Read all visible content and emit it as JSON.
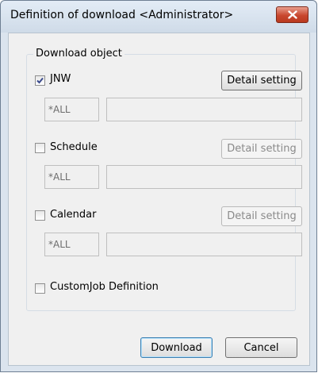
{
  "window": {
    "title": "Definition of download <Administrator>"
  },
  "icons": {
    "close": "close-icon",
    "check": "checkmark-icon"
  },
  "group": {
    "label": "Download object"
  },
  "items": [
    {
      "label": "JNW",
      "checked": true,
      "detail_label": "Detail setting",
      "detail_enabled": true,
      "code_value": "*ALL",
      "desc_value": ""
    },
    {
      "label": "Schedule",
      "checked": false,
      "detail_label": "Detail setting",
      "detail_enabled": false,
      "code_value": "*ALL",
      "desc_value": ""
    },
    {
      "label": "Calendar",
      "checked": false,
      "detail_label": "Detail setting",
      "detail_enabled": false,
      "code_value": "*ALL",
      "desc_value": ""
    }
  ],
  "custom_job": {
    "label": "CustomJob Definition",
    "checked": false
  },
  "buttons": {
    "download": "Download",
    "cancel": "Cancel"
  }
}
